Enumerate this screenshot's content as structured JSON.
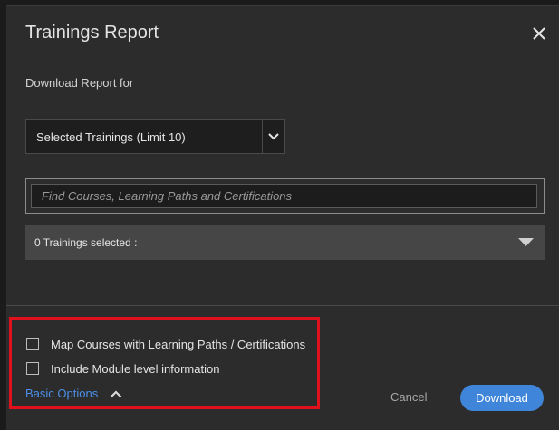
{
  "dialog": {
    "title": "Trainings Report",
    "subheading": "Download Report for"
  },
  "report_for_select": {
    "selected": "Selected Trainings (Limit 10)"
  },
  "search": {
    "value": "",
    "placeholder": "Find Courses, Learning Paths and Certifications"
  },
  "selection_summary": {
    "text": "0 Trainings selected :"
  },
  "options": {
    "map_courses": {
      "label": "Map Courses with Learning Paths / Certifications",
      "checked": false
    },
    "module_info": {
      "label": "Include Module level information",
      "checked": false
    },
    "toggle_label": "Basic Options"
  },
  "actions": {
    "cancel_label": "Cancel",
    "download_label": "Download"
  },
  "icons": {
    "close": "close-icon",
    "select_chevron": "chevron-down-icon",
    "summary_caret": "caret-down-icon",
    "options_chevron": "chevron-up-icon"
  },
  "colors": {
    "accent": "#3f86da",
    "link": "#4a8fe8",
    "highlight": "#e0101c",
    "dialog_bg": "#2c2c2c"
  }
}
